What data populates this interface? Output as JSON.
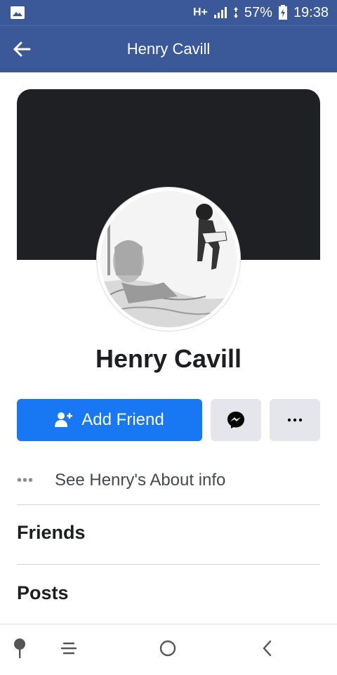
{
  "status_bar": {
    "network": "H+",
    "battery": "57%",
    "time": "19:38",
    "icons": [
      "gallery-icon",
      "signal-icon",
      "data-transfer-icon",
      "battery-charging-icon"
    ]
  },
  "app_bar": {
    "title": "Henry Cavill",
    "back_icon": "arrow-left-icon"
  },
  "profile": {
    "name": "Henry Cavill",
    "cover_color": "#1f2024"
  },
  "actions": {
    "add_friend_label": "Add Friend",
    "add_friend_icon": "add-person-icon",
    "messenger_icon": "messenger-icon",
    "more_icon": "more-horizontal-icon",
    "accent_color": "#1877f2"
  },
  "about": {
    "dots": "•••",
    "text": "See Henry's About info"
  },
  "sections": {
    "friends": "Friends",
    "posts": "Posts"
  },
  "bottom_nav": {
    "items": [
      "pin-icon",
      "menu-icon",
      "home-circle-icon",
      "back-chevron-icon"
    ]
  }
}
